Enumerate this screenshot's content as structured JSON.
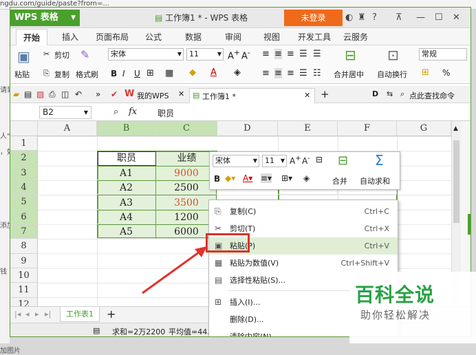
{
  "background": {
    "url_fragment": "ngdu.com/guide/paste?from=...",
    "side_texts": [
      "请到",
      "人\"",
      "，如",
      "添加",
      "钱"
    ],
    "bottom_text": "加图片"
  },
  "window": {
    "app_button": "WPS 表格",
    "title": "工作簿1 * - WPS 表格",
    "login_button": "未登录",
    "icons": [
      "skin-icon",
      "shirt-icon",
      "help-icon",
      "restore-icon",
      "minimize-icon",
      "maximize-icon",
      "close-icon"
    ]
  },
  "ribbon": {
    "tabs": [
      "开始",
      "插入",
      "页面布局",
      "公式",
      "数据",
      "审阅",
      "视图",
      "开发工具",
      "云服务"
    ],
    "paste": "粘贴",
    "cut": "剪切",
    "copy": "复制",
    "format_painter": "格式刷",
    "font_name": "宋体",
    "font_size": "11",
    "merge_center": "合并居中",
    "wrap_text": "自动换行",
    "number_format": "常规",
    "percent": "%"
  },
  "doctabs": {
    "my_wps": "我的WPS",
    "workbook": "工作簿1 *",
    "right_search": "点此查找命令"
  },
  "formula_bar": {
    "cell_ref": "B2",
    "fx": "fx",
    "content": "职员"
  },
  "columns": [
    "A",
    "B",
    "C",
    "D",
    "E",
    "F",
    "G"
  ],
  "rows": [
    "1",
    "2",
    "3",
    "4",
    "5",
    "6",
    "7",
    "8",
    "9",
    "10",
    "11",
    "12"
  ],
  "table": {
    "header": [
      "职员",
      "业绩"
    ],
    "rows": [
      [
        "A1",
        "9000"
      ],
      [
        "A2",
        "2500"
      ],
      [
        "A3",
        "3500"
      ],
      [
        "A4",
        "1200"
      ],
      [
        "A5",
        "6000"
      ]
    ]
  },
  "paste_preview": {
    "name": "A1",
    "value": "9000"
  },
  "mini_toolbar": {
    "font": "宋体",
    "size": "11",
    "merge": "合并",
    "autosum": "自动求和"
  },
  "context_menu": [
    {
      "label": "复制(C)",
      "shortcut": "Ctrl+C",
      "icon": "copy-icon"
    },
    {
      "label": "剪切(T)",
      "shortcut": "Ctrl+X",
      "icon": "scissors-icon"
    },
    {
      "label": "粘贴(P)",
      "shortcut": "Ctrl+V",
      "icon": "paste-icon"
    },
    {
      "label": "粘贴为数值(V)",
      "shortcut": "Ctrl+Shift+V",
      "icon": "paste-values-icon"
    },
    {
      "label": "选择性粘贴(S)...",
      "shortcut": "",
      "icon": "paste-special-icon"
    },
    {
      "label": "插入(I)...",
      "shortcut": "",
      "icon": "insert-icon"
    },
    {
      "label": "删除(D)...",
      "shortcut": "",
      "icon": ""
    },
    {
      "label": "清除内容(N)",
      "shortcut": "",
      "icon": ""
    }
  ],
  "sheet_tab": "工作表1",
  "status": {
    "sum": "求和=2万2200",
    "avg": "平均值=44..."
  },
  "watermark": {
    "title": "百科全说",
    "subtitle": "助你轻松解决"
  },
  "colors": {
    "accent": "#4aa02c",
    "login": "#ef6a1a",
    "red_value": "#d2522b",
    "highlight_box": "#d9342b"
  }
}
